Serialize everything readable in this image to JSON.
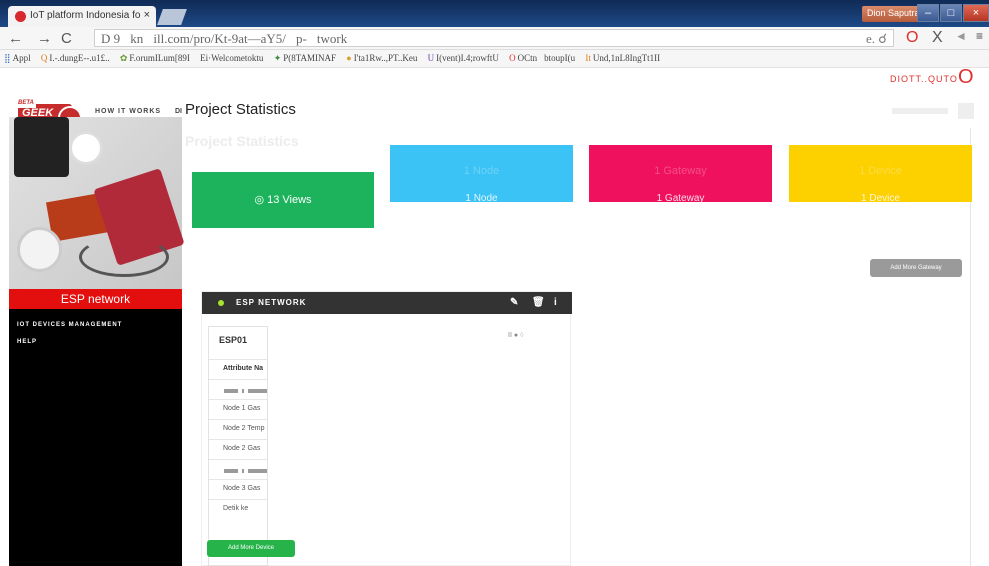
{
  "browser": {
    "tab_title": "IoT platform Indonesia fo",
    "tab_close": "×",
    "user": "Dion Saputra",
    "url": "D 9\u0000kn\u0000ill.com/pro/Kt-9at—aY5/\u0000p-\u0000twork",
    "url_right": "e. ☌",
    "bookmarks": [
      "Appl",
      "I.-.dungE--.u1£..",
      "F.orumILum[89I",
      "Ei·Welcometoktu",
      "P(8TAMINAF",
      "I'ta1Rw..,PT..Keu",
      "I(vent)I.4;rowftU",
      "OCtn\u0000btoupI(u",
      "Und,1nL8IngTt1II"
    ],
    "ext_label": "DIOTT..QUTO",
    "ext_icon": "O"
  },
  "site": {
    "logo_beta": "BETA",
    "logo_text": "GEEK NESIA",
    "nav_how": "HOW IT WORKS",
    "nav_dis": "DI",
    "page_title": "Project Statistics",
    "page_title_ghost": "Project Statistics"
  },
  "sidebar": {
    "section_label": "ESP network",
    "menu": [
      "IOT DEVICES MANAGEMENT",
      "HELP"
    ]
  },
  "stats": {
    "views": "◎ 13 Views",
    "cards": [
      {
        "top": "1 Node",
        "bottom": "1 Node",
        "color": "#3bc3f5"
      },
      {
        "top": "1 Gateway",
        "bottom": "1 Gateway",
        "color": "#f0115e"
      },
      {
        "top": "1 Device",
        "bottom": "1 Device",
        "color": "#fdd000"
      }
    ],
    "add_gateway": "Add More Gateway"
  },
  "panel": {
    "title": "ESP NETWORK",
    "device": "ESP01",
    "header": "Attribute Na",
    "rows": [
      "Node 1 Gas",
      "Node 2 Temp",
      "Node 2 Gas",
      "Node 3 Gas",
      "Detik ke"
    ],
    "toggle": "II ●",
    "add_device": "Add More Device"
  }
}
